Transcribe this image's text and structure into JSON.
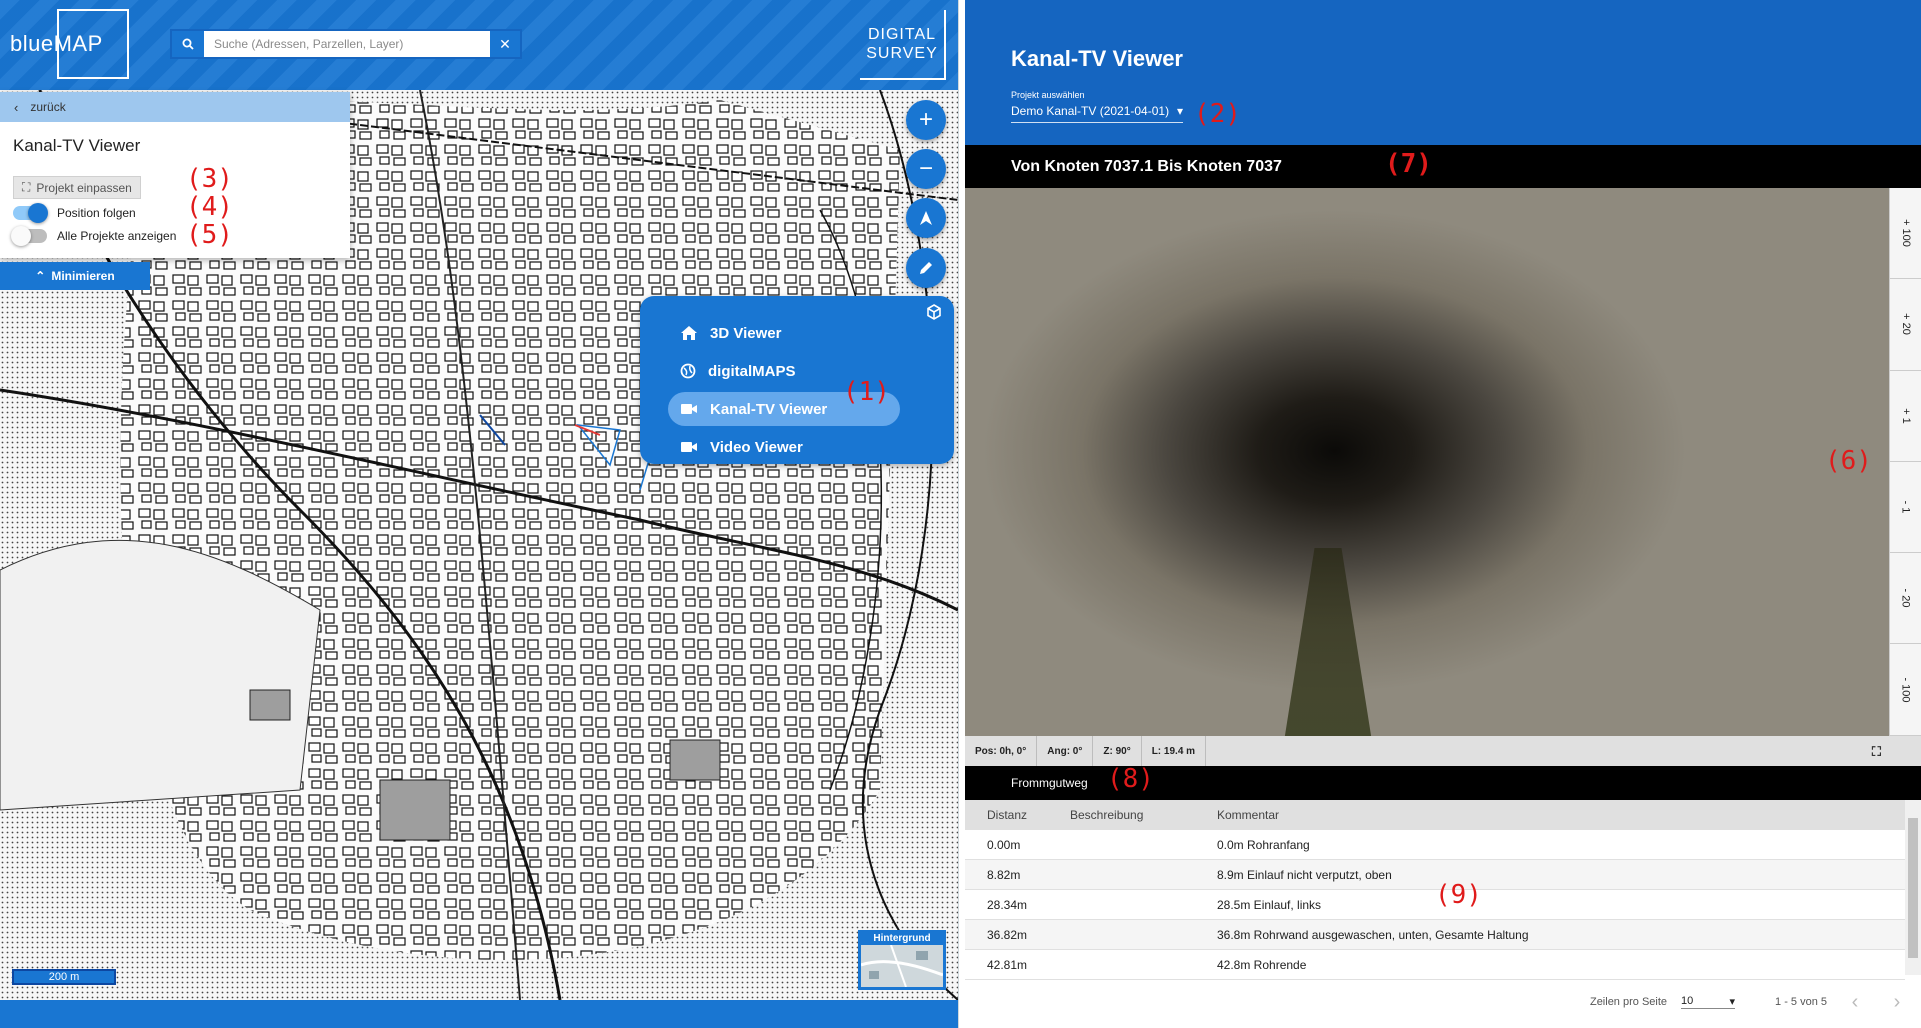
{
  "map_app": {
    "logo_text": "blueMAP",
    "search_placeholder": "Suche (Adressen, Parzellen, Layer)",
    "digital_survey_logo": [
      "DIGITAL",
      "SURVEY"
    ],
    "panel": {
      "back_label": "zurück",
      "title": "Kanal-TV Viewer",
      "fit_project_label": "Projekt einpassen",
      "follow_position_label": "Position folgen",
      "follow_position_on": true,
      "show_all_projects_label": "Alle Projekte anzeigen",
      "show_all_projects_on": false,
      "minimize_label": "Minimieren"
    },
    "app_menu": [
      {
        "label": "3D Viewer",
        "icon": "home-icon",
        "active": false
      },
      {
        "label": "digitalMAPS",
        "icon": "globe-icon",
        "active": false
      },
      {
        "label": "Kanal-TV Viewer",
        "icon": "video-camera-icon",
        "active": true
      },
      {
        "label": "Video Viewer",
        "icon": "video-camera-icon",
        "active": false
      }
    ],
    "map_buttons": [
      "zoom-in-button",
      "zoom-out-button",
      "locate-button",
      "draw-button"
    ],
    "scale_label": "200 m",
    "background_label": "Hintergrund"
  },
  "annotations": {
    "a1": "(1)",
    "a2": "(2)",
    "a3": "(3)",
    "a4": "(4)",
    "a5": "(5)",
    "a6": "(6)",
    "a7": "(7)",
    "a8": "(8)",
    "a9": "(9)"
  },
  "viewer": {
    "title": "Kanal-TV Viewer",
    "project_label": "Projekt auswählen",
    "project_value": "Demo Kanal-TV (2021-04-01)",
    "pipe_title": "Von Knoten 7037.1 Bis Knoten 7037",
    "zoom_steps": [
      "+ 100",
      "+ 20",
      "+ 1",
      "- 1",
      "- 20",
      "- 100"
    ],
    "status": {
      "pos": "Pos: 0h, 0°",
      "ang": "Ang: 0°",
      "z": "Z: 90°",
      "length": "L: 19.4 m"
    },
    "street": "Frommgutweg",
    "table": {
      "headers": [
        "Distanz",
        "Beschreibung",
        "Kommentar"
      ],
      "rows": [
        {
          "distanz": "0.00m",
          "beschreibung": "",
          "kommentar": "0.0m Rohranfang"
        },
        {
          "distanz": "8.82m",
          "beschreibung": "",
          "kommentar": "8.9m Einlauf nicht verputzt, oben"
        },
        {
          "distanz": "28.34m",
          "beschreibung": "",
          "kommentar": "28.5m Einlauf, links"
        },
        {
          "distanz": "36.82m",
          "beschreibung": "",
          "kommentar": "36.8m Rohrwand ausgewaschen, unten, Gesamte Haltung"
        },
        {
          "distanz": "42.81m",
          "beschreibung": "",
          "kommentar": "42.8m Rohrende"
        }
      ]
    },
    "pagination": {
      "rows_per_page_label": "Zeilen pro Seite",
      "rows_per_page": "10",
      "range": "1 - 5 von 5"
    }
  },
  "colors": {
    "brand_blue": "#1976d2",
    "header_blue": "#1565c0",
    "annotation_red": "#e01b1b"
  }
}
